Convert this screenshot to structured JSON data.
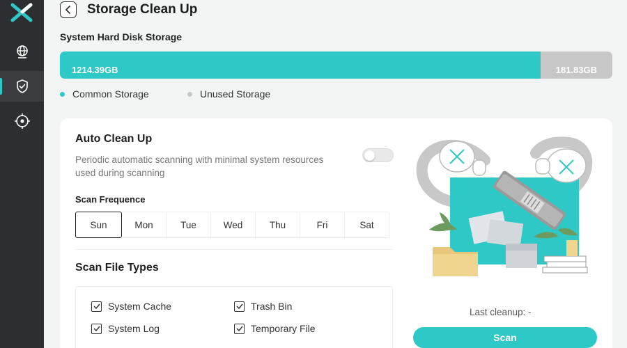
{
  "page": {
    "title": "Storage Clean Up"
  },
  "sidebar": {
    "items": [
      {
        "name": "globe-icon"
      },
      {
        "name": "shield-icon",
        "active": true
      },
      {
        "name": "crosshair-icon"
      }
    ]
  },
  "storage": {
    "title": "System Hard Disk Storage",
    "used_label": "1214.39GB",
    "free_label": "181.83GB",
    "used_fraction": 0.87,
    "legend": [
      {
        "label": "Common Storage",
        "color": "#2ec8c6"
      },
      {
        "label": "Unused Storage",
        "color": "#c7c7c7"
      }
    ]
  },
  "auto_clean": {
    "title": "Auto Clean Up",
    "description": "Periodic automatic scanning with minimal system resources used during scanning",
    "enabled": false
  },
  "scan_frequency": {
    "title": "Scan Frequence",
    "days": [
      "Sun",
      "Mon",
      "Tue",
      "Wed",
      "Thu",
      "Fri",
      "Sat"
    ],
    "selected": "Sun"
  },
  "file_types": {
    "title": "Scan File Types",
    "items": [
      {
        "label": "System Cache",
        "checked": true
      },
      {
        "label": "Trash Bin",
        "checked": true
      },
      {
        "label": "System Log",
        "checked": true
      },
      {
        "label": "Temporary File",
        "checked": true
      }
    ]
  },
  "scan": {
    "last_cleanup": "Last cleanup: -",
    "button_label": "Scan"
  },
  "colors": {
    "accent": "#2ec8c6",
    "sidebar_bg": "#2c2e31",
    "unused": "#c7c7c7"
  }
}
